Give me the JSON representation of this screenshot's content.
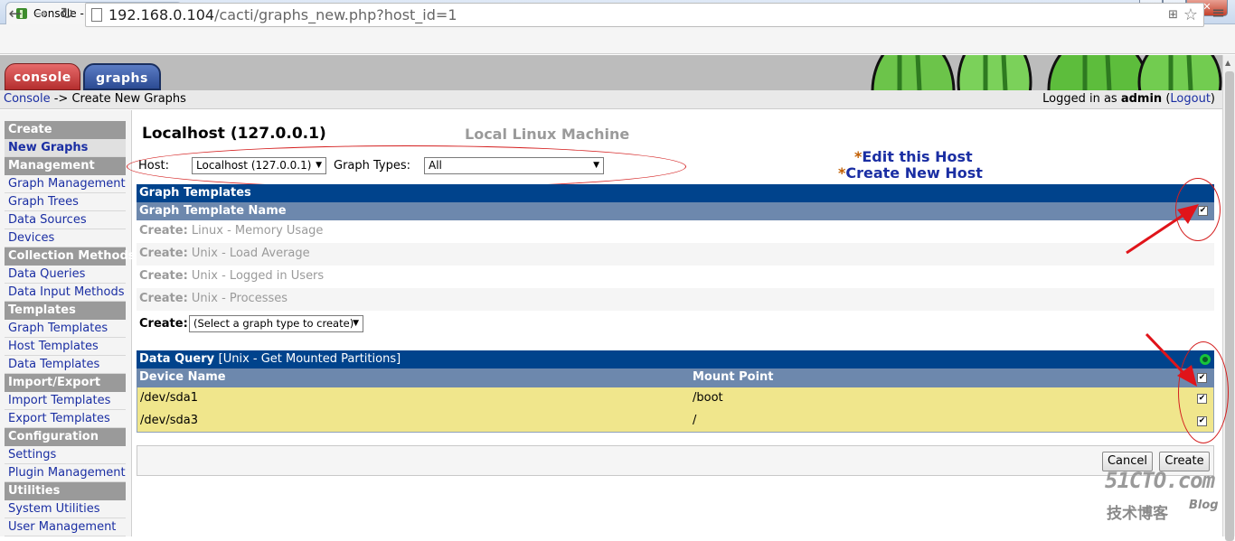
{
  "browser": {
    "tab_title": "Console -> Create New",
    "url_host": "192.168.0.104",
    "url_path": "/cacti/graphs_new.php?host_id=1"
  },
  "header": {
    "tabs": [
      {
        "label": "console"
      },
      {
        "label": "graphs"
      }
    ],
    "breadcrumb_link": "Console",
    "breadcrumb_rest": " -> Create New Graphs",
    "login_prefix": "Logged in as ",
    "login_user": "admin",
    "logout_open": " (",
    "logout_label": "Logout",
    "logout_close": ")"
  },
  "sidebar": {
    "items": [
      {
        "label": "Create",
        "type": "header"
      },
      {
        "label": "New Graphs",
        "type": "item",
        "active": true
      },
      {
        "label": "Management",
        "type": "header"
      },
      {
        "label": "Graph Management",
        "type": "item"
      },
      {
        "label": "Graph Trees",
        "type": "item"
      },
      {
        "label": "Data Sources",
        "type": "item"
      },
      {
        "label": "Devices",
        "type": "item"
      },
      {
        "label": "Collection Methods",
        "type": "header"
      },
      {
        "label": "Data Queries",
        "type": "item"
      },
      {
        "label": "Data Input Methods",
        "type": "item"
      },
      {
        "label": "Templates",
        "type": "header"
      },
      {
        "label": "Graph Templates",
        "type": "item"
      },
      {
        "label": "Host Templates",
        "type": "item"
      },
      {
        "label": "Data Templates",
        "type": "item"
      },
      {
        "label": "Import/Export",
        "type": "header"
      },
      {
        "label": "Import Templates",
        "type": "item"
      },
      {
        "label": "Export Templates",
        "type": "item"
      },
      {
        "label": "Configuration",
        "type": "header"
      },
      {
        "label": "Settings",
        "type": "item"
      },
      {
        "label": "Plugin Management",
        "type": "item"
      },
      {
        "label": "Utilities",
        "type": "header"
      },
      {
        "label": "System Utilities",
        "type": "item"
      },
      {
        "label": "User Management",
        "type": "item"
      }
    ]
  },
  "main": {
    "host_title": "Localhost (127.0.0.1)",
    "host_description": "Local Linux Machine",
    "host_label": "Host:",
    "host_value": "Localhost (127.0.0.1)",
    "graph_types_label": "Graph Types:",
    "graph_types_value": "All",
    "edit_host": "Edit this Host",
    "create_host": "Create New Host",
    "star": "*"
  },
  "graph_templates": {
    "title": "Graph Templates",
    "column": "Graph Template Name",
    "select_all_checked": true,
    "rows": [
      {
        "prefix": "Create:",
        "name": "Linux - Memory Usage"
      },
      {
        "prefix": "Create:",
        "name": "Unix - Load Average"
      },
      {
        "prefix": "Create:",
        "name": "Unix - Logged in Users"
      },
      {
        "prefix": "Create:",
        "name": "Unix - Processes"
      }
    ],
    "create_label": "Create:",
    "create_select": "(Select a graph type to create)"
  },
  "data_query": {
    "title": "Data Query",
    "query_name": "[Unix - Get Mounted Partitions]",
    "col_device": "Device Name",
    "col_mount": "Mount Point",
    "select_all_checked": true,
    "rows": [
      {
        "device": "/dev/sda1",
        "mount": "/boot",
        "checked": true
      },
      {
        "device": "/dev/sda3",
        "mount": "/",
        "checked": true
      }
    ]
  },
  "actions": {
    "cancel": "Cancel",
    "create": "Create"
  },
  "watermark": {
    "main": "51CTO.com",
    "sub": "技术博客",
    "blog": "Blog"
  }
}
